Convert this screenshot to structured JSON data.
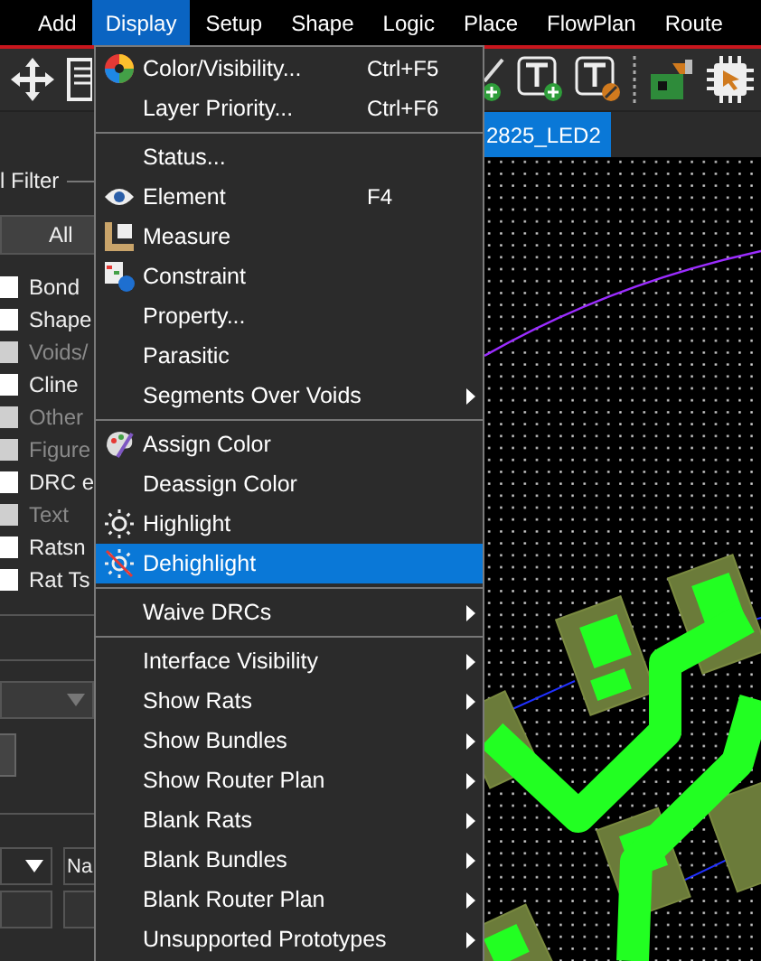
{
  "menubar": {
    "items": [
      {
        "label": "Add",
        "selected": false
      },
      {
        "label": "Display",
        "selected": true
      },
      {
        "label": "Setup",
        "selected": false
      },
      {
        "label": "Shape",
        "selected": false
      },
      {
        "label": "Logic",
        "selected": false
      },
      {
        "label": "Place",
        "selected": false
      },
      {
        "label": "FlowPlan",
        "selected": false
      },
      {
        "label": "Route",
        "selected": false
      }
    ]
  },
  "tabs": [
    {
      "label": "2825_LED2",
      "selected": true
    }
  ],
  "filter_panel": {
    "title": "l Filter",
    "button": "All",
    "items": [
      {
        "label": "Bond",
        "checked": false,
        "disabled": false
      },
      {
        "label": "Shape",
        "checked": false,
        "disabled": false
      },
      {
        "label": "Voids/",
        "checked": false,
        "disabled": true
      },
      {
        "label": "Cline",
        "checked": false,
        "disabled": false
      },
      {
        "label": "Other",
        "checked": false,
        "disabled": true
      },
      {
        "label": "Figure",
        "checked": false,
        "disabled": true
      },
      {
        "label": "DRC e",
        "checked": false,
        "disabled": false
      },
      {
        "label": "Text",
        "checked": false,
        "disabled": true
      },
      {
        "label": "Ratsn",
        "checked": false,
        "disabled": false
      },
      {
        "label": "Rat Ts",
        "checked": false,
        "disabled": false
      }
    ],
    "field_label": "Na"
  },
  "menu": {
    "items": [
      {
        "kind": "item",
        "label": "Color/Visibility...",
        "shortcut": "Ctrl+F5",
        "submenu": false,
        "selected": false
      },
      {
        "kind": "item",
        "label": "Layer Priority...",
        "shortcut": "Ctrl+F6",
        "submenu": false,
        "selected": false
      },
      {
        "kind": "separator"
      },
      {
        "kind": "item",
        "label": "Status...",
        "submenu": false,
        "selected": false
      },
      {
        "kind": "item",
        "label": "Element",
        "shortcut": "F4",
        "submenu": false,
        "selected": false
      },
      {
        "kind": "item",
        "label": "Measure",
        "submenu": false,
        "selected": false
      },
      {
        "kind": "item",
        "label": "Constraint",
        "submenu": false,
        "selected": false
      },
      {
        "kind": "item",
        "label": "Property...",
        "submenu": false,
        "selected": false
      },
      {
        "kind": "item",
        "label": "Parasitic",
        "submenu": false,
        "selected": false
      },
      {
        "kind": "item",
        "label": "Segments Over Voids",
        "submenu": true,
        "selected": false
      },
      {
        "kind": "separator"
      },
      {
        "kind": "item",
        "label": "Assign Color",
        "submenu": false,
        "selected": false
      },
      {
        "kind": "item",
        "label": "Deassign Color",
        "submenu": false,
        "selected": false
      },
      {
        "kind": "item",
        "label": "Highlight",
        "submenu": false,
        "selected": false
      },
      {
        "kind": "item",
        "label": "Dehighlight",
        "submenu": false,
        "selected": true
      },
      {
        "kind": "separator"
      },
      {
        "kind": "item",
        "label": "Waive DRCs",
        "submenu": true,
        "selected": false
      },
      {
        "kind": "separator"
      },
      {
        "kind": "item",
        "label": "Interface Visibility",
        "submenu": true,
        "selected": false
      },
      {
        "kind": "item",
        "label": "Show Rats",
        "submenu": true,
        "selected": false
      },
      {
        "kind": "item",
        "label": "Show Bundles",
        "submenu": true,
        "selected": false
      },
      {
        "kind": "item",
        "label": "Show Router Plan",
        "submenu": true,
        "selected": false
      },
      {
        "kind": "item",
        "label": "Blank Rats",
        "submenu": true,
        "selected": false
      },
      {
        "kind": "item",
        "label": "Blank Bundles",
        "submenu": true,
        "selected": false
      },
      {
        "kind": "item",
        "label": "Blank Router Plan",
        "submenu": true,
        "selected": false
      },
      {
        "kind": "item",
        "label": "Unsupported Prototypes",
        "submenu": true,
        "selected": false
      }
    ]
  }
}
